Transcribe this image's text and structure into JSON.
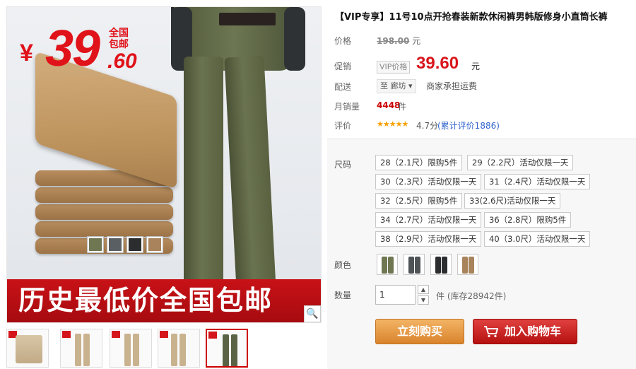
{
  "product": {
    "title": "【VIP专享】11号10点开抢春装新款休闲裤男韩版修身小直筒长裤"
  },
  "hero": {
    "price_symbol": "¥",
    "price_big": "39",
    "price_cents": ".60",
    "free_ship_badge": "全国包邮",
    "banner_text": "历史最低价全国包邮",
    "swatch_colors": [
      "#6f7752",
      "#5a5f63",
      "#2b2d2f",
      "#a8835b"
    ]
  },
  "thumbnails": [
    {
      "name": "thumb-1"
    },
    {
      "name": "thumb-2"
    },
    {
      "name": "thumb-3"
    },
    {
      "name": "thumb-4"
    },
    {
      "name": "thumb-5"
    }
  ],
  "info": {
    "original_price_label": "价格",
    "original_price": "198.00",
    "currency_unit": "元",
    "promo_label": "促销",
    "vip_tag": "VIP价格",
    "promo_price": "39.60",
    "shipping_label": "配送",
    "ship_from": "至 廊坊",
    "ship_text": "商家承担运费",
    "sales_label": "月销量",
    "sales_count": "4448",
    "sales_unit": "件",
    "rating_label": "评价",
    "rating_score": "4.7分",
    "rating_link": "(累计评价1886)"
  },
  "sku": {
    "size_label": "尺码",
    "sizes": [
      "28（2.1尺）限购5件",
      "29（2.2尺）活动仅限一天",
      "30（2.3尺）活动仅限一天",
      "31（2.4尺）活动仅限一天",
      "32（2.5尺）限购5件",
      "33(2.6尺)活动仅限一天",
      "34（2.7尺）活动仅限一天",
      "36（2.8尺）限购5件",
      "38（2.9尺）活动仅限一天",
      "40（3.0尺）活动仅限一天"
    ],
    "color_label": "颜色",
    "colors": [
      "#6f7752",
      "#4f5356",
      "#2b2d2f",
      "#a8835b"
    ],
    "qty_label": "数量",
    "qty_value": "1",
    "stock_text": "件 (库存28942件)",
    "buy_now": "立刻购买",
    "add_cart": "加入购物车"
  }
}
